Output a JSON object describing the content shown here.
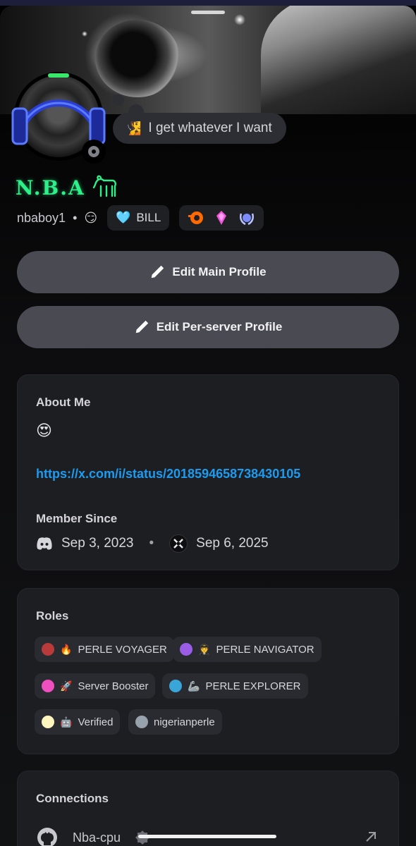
{
  "profile": {
    "custom_status": "I get whatever I want",
    "custom_status_emoji": "🧏",
    "display_name": "N.B.A",
    "display_name_emoji_icon": "goat-icon",
    "username": "nbaboy1",
    "username_emoji": "😏",
    "separator": "•",
    "clan_tag": "BILL",
    "clan_tag_emoji": "🩵",
    "badges": [
      "hypesquad-icon",
      "nitro-gem-icon",
      "laurel-badge-icon"
    ]
  },
  "buttons": {
    "edit_main": "Edit Main Profile",
    "edit_server": "Edit Per-server Profile"
  },
  "about": {
    "title": "About Me",
    "emoji": "😍",
    "link": "https://x.com/i/status/2018594658738430105"
  },
  "member_since": {
    "title": "Member Since",
    "discord_date": "Sep 3, 2023",
    "separator": "•",
    "server_date": "Sep 6, 2025"
  },
  "roles": {
    "title": "Roles",
    "items": [
      {
        "color": "#b83a3a",
        "emoji": "🔥",
        "name": "PERLE VOYAGER"
      },
      {
        "color": "#9b5de5",
        "emoji": "🧑‍✈️",
        "name": "PERLE NAVIGATOR"
      },
      {
        "color": "#f04fbf",
        "emoji": "🚀",
        "name": "Server Booster"
      },
      {
        "color": "#3aa6d8",
        "emoji": "🦾",
        "name": "PERLE EXPLORER"
      },
      {
        "color": "#fff6bf",
        "emoji": "🤖",
        "name": "Verified"
      },
      {
        "color": "#98a2ad",
        "emoji": "",
        "name": "nigerianperle"
      }
    ]
  },
  "connections": {
    "title": "Connections",
    "items": [
      {
        "service_icon": "github-icon",
        "name": "Nba-cpu"
      }
    ]
  },
  "colors": {
    "accent_link": "#1d9bf0",
    "display_name": "#2ef08a",
    "button_bg": "#4a4b52",
    "card_bg": "#1d1e22"
  }
}
